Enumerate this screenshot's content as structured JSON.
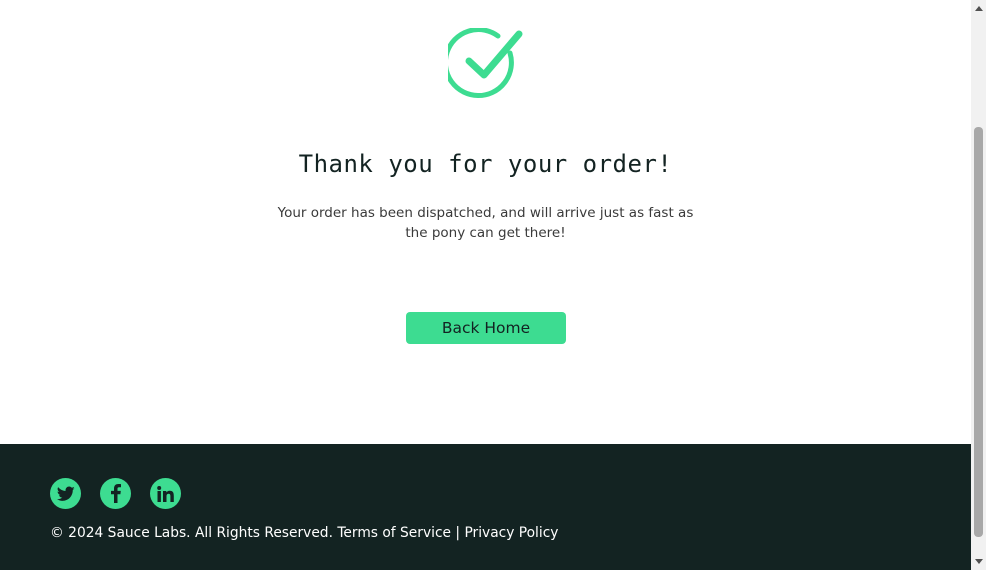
{
  "checkout_complete": {
    "icon": "checkmark-circle-icon",
    "header": "Thank you for your order!",
    "text": "Your order has been dispatched, and will arrive just as fast as the pony can get there!",
    "back_button_label": "Back Home"
  },
  "footer": {
    "social": [
      {
        "name": "twitter",
        "icon": "twitter-icon"
      },
      {
        "name": "facebook",
        "icon": "facebook-icon"
      },
      {
        "name": "linkedin",
        "icon": "linkedin-icon"
      }
    ],
    "copy": "© 2024 Sauce Labs. All Rights Reserved. Terms of Service | Privacy Policy"
  },
  "colors": {
    "accent": "#3ddc91",
    "footer_bg": "#132322",
    "text_dark": "#132322"
  }
}
